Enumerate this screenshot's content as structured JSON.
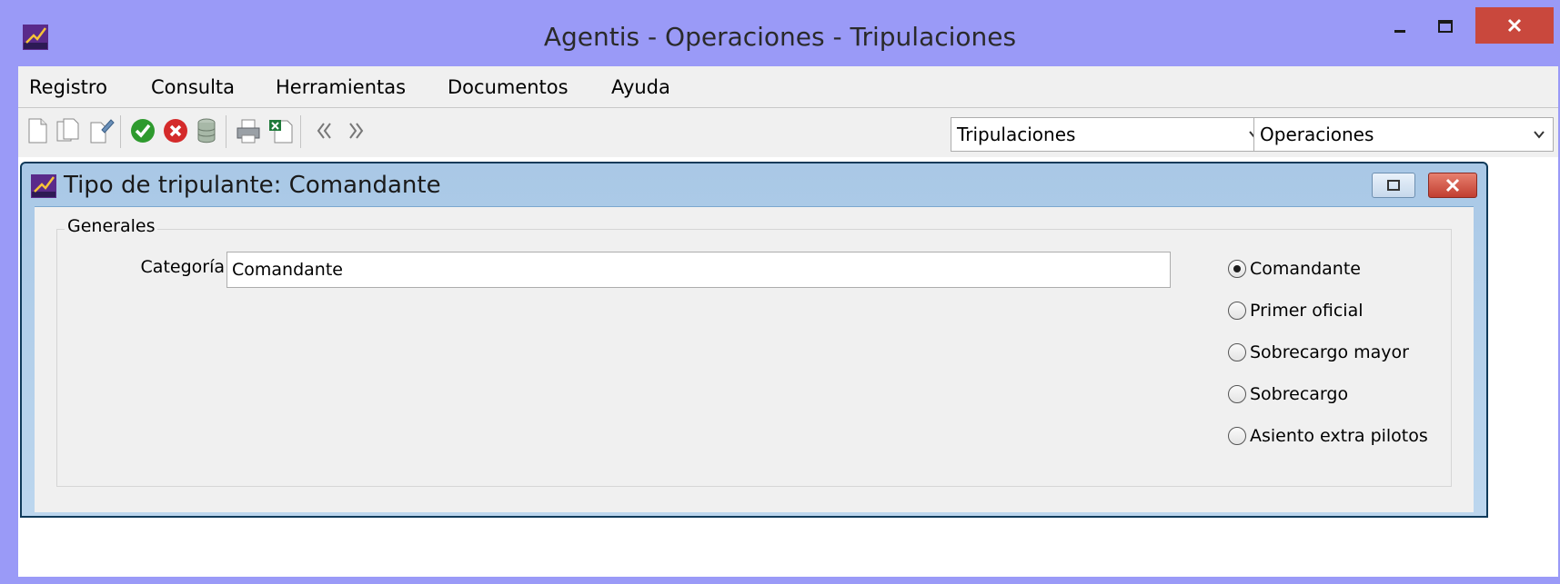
{
  "window": {
    "title": "Agentis - Operaciones - Tripulaciones",
    "close_color": "#c9483d",
    "frame_color": "#9a9af7"
  },
  "menu": {
    "items": [
      {
        "label": "Registro"
      },
      {
        "label": "Consulta"
      },
      {
        "label": "Herramientas"
      },
      {
        "label": "Documentos"
      },
      {
        "label": "Ayuda"
      }
    ]
  },
  "toolbar": {
    "icons": [
      "new-document-icon",
      "copy-document-icon",
      "edit-document-icon",
      "accept-icon",
      "cancel-icon",
      "database-icon",
      "print-icon",
      "excel-export-icon",
      "previous-icon",
      "next-icon"
    ],
    "combo_module": {
      "value": "Tripulaciones"
    },
    "combo_area": {
      "value": "Operaciones"
    }
  },
  "form": {
    "title": "Tipo de tripulante: Comandante",
    "group_label": "Generales",
    "category_label": "Categoría",
    "category_value": "Comandante",
    "radio_options": [
      {
        "label": "Comandante",
        "checked": true
      },
      {
        "label": "Primer oficial",
        "checked": false
      },
      {
        "label": "Sobrecargo mayor",
        "checked": false
      },
      {
        "label": "Sobrecargo",
        "checked": false
      },
      {
        "label": "Asiento extra pilotos",
        "checked": false
      }
    ]
  }
}
